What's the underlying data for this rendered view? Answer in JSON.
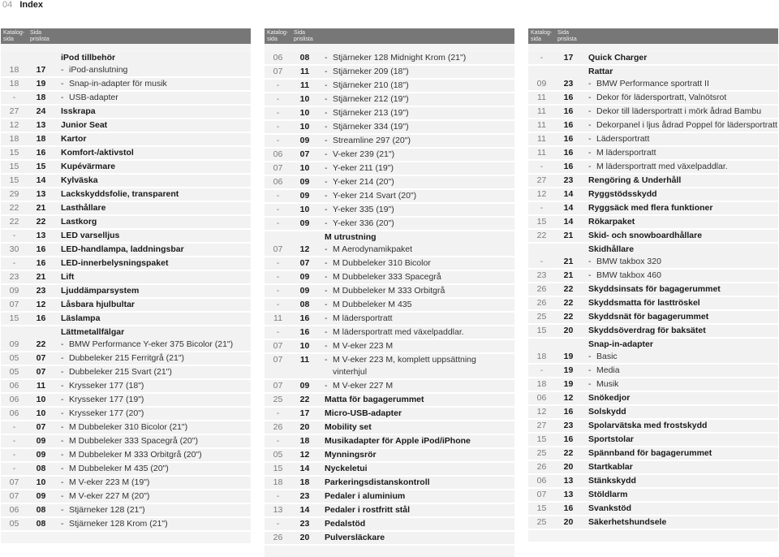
{
  "header": {
    "page_number": "04",
    "title": "Index"
  },
  "column_headers": {
    "katalog": "Katalog- sida",
    "sida": "Sida prislista"
  },
  "columns": [
    {
      "rows": [
        {
          "type": "heading",
          "label": "iPod tillbehör"
        },
        {
          "type": "sub",
          "kat": "18",
          "sida": "17",
          "label": "iPod-anslutning"
        },
        {
          "type": "sub",
          "kat": "18",
          "sida": "19",
          "label": "Snap-in-adapter för musik"
        },
        {
          "type": "sub",
          "kat": "-",
          "sida": "18",
          "label": "USB-adapter"
        },
        {
          "type": "bold",
          "kat": "27",
          "sida": "24",
          "label": "Isskrapa"
        },
        {
          "type": "bold",
          "kat": "12",
          "sida": "13",
          "label": "Junior Seat"
        },
        {
          "type": "bold",
          "kat": "18",
          "sida": "18",
          "label": "Kartor"
        },
        {
          "type": "bold",
          "kat": "15",
          "sida": "16",
          "label": "Komfort-/aktivstol"
        },
        {
          "type": "bold",
          "kat": "15",
          "sida": "15",
          "label": "Kupévärmare"
        },
        {
          "type": "bold",
          "kat": "15",
          "sida": "14",
          "label": "Kylväska"
        },
        {
          "type": "bold",
          "kat": "29",
          "sida": "13",
          "label": "Lackskyddsfolie, transparent"
        },
        {
          "type": "bold",
          "kat": "22",
          "sida": "21",
          "label": "Lasthållare"
        },
        {
          "type": "bold",
          "kat": "22",
          "sida": "22",
          "label": "Lastkorg"
        },
        {
          "type": "bold",
          "kat": "-",
          "sida": "13",
          "label": "LED varselljus"
        },
        {
          "type": "bold",
          "kat": "30",
          "sida": "16",
          "label": "LED-handlampa, laddningsbar"
        },
        {
          "type": "bold",
          "kat": "-",
          "sida": "16",
          "label": "LED-innerbelysningspaket"
        },
        {
          "type": "bold",
          "kat": "23",
          "sida": "21",
          "label": "Lift"
        },
        {
          "type": "bold",
          "kat": "09",
          "sida": "23",
          "label": "Ljuddämparsystem"
        },
        {
          "type": "bold",
          "kat": "07",
          "sida": "12",
          "label": "Låsbara hjulbultar"
        },
        {
          "type": "bold",
          "kat": "15",
          "sida": "16",
          "label": "Läslampa"
        },
        {
          "type": "heading",
          "label": "Lättmetallfälgar"
        },
        {
          "type": "sub",
          "kat": "09",
          "sida": "22",
          "label": "BMW Performance Y-eker 375 Bicolor (21\")"
        },
        {
          "type": "sub",
          "kat": "05",
          "sida": "07",
          "label": "Dubbeleker 215 Ferritgrå (21\")"
        },
        {
          "type": "sub",
          "kat": "05",
          "sida": "07",
          "label": "Dubbeleker 215 Svart (21\")"
        },
        {
          "type": "sub",
          "kat": "06",
          "sida": "11",
          "label": "Krysseker 177 (18\")"
        },
        {
          "type": "sub",
          "kat": "06",
          "sida": "10",
          "label": "Krysseker 177 (19\")"
        },
        {
          "type": "sub",
          "kat": "06",
          "sida": "10",
          "label": "Krysseker 177 (20\")"
        },
        {
          "type": "sub",
          "kat": "-",
          "sida": "07",
          "label": "M Dubbeleker 310 Bicolor (21\")"
        },
        {
          "type": "sub",
          "kat": "-",
          "sida": "09",
          "label": "M Dubbeleker 333 Spacegrå (20\")"
        },
        {
          "type": "sub",
          "kat": "-",
          "sida": "09",
          "label": "M Dubbeleker M 333 Orbitgrå (20\")"
        },
        {
          "type": "sub",
          "kat": "-",
          "sida": "08",
          "label": "M Dubbeleker M 435 (20\")"
        },
        {
          "type": "sub",
          "kat": "07",
          "sida": "10",
          "label": "M V-eker 223 M (19\")"
        },
        {
          "type": "sub",
          "kat": "07",
          "sida": "09",
          "label": "M V-eker 227 M (20\")"
        },
        {
          "type": "sub",
          "kat": "06",
          "sida": "08",
          "label": "Stjärneker 128 (21\")"
        },
        {
          "type": "sub",
          "kat": "05",
          "sida": "08",
          "label": "Stjärneker 128 Krom (21\")"
        }
      ]
    },
    {
      "rows": [
        {
          "type": "sub",
          "kat": "06",
          "sida": "08",
          "label": "Stjärneker 128 Midnight Krom (21\")"
        },
        {
          "type": "sub",
          "kat": "07",
          "sida": "11",
          "label": "Stjärneker 209 (18\")"
        },
        {
          "type": "sub",
          "kat": "-",
          "sida": "11",
          "label": "Stjärneker 210 (18\")"
        },
        {
          "type": "sub",
          "kat": "-",
          "sida": "10",
          "label": "Stjärneker 212 (19\")"
        },
        {
          "type": "sub",
          "kat": "-",
          "sida": "10",
          "label": "Stjärneker 213 (19\")"
        },
        {
          "type": "sub",
          "kat": "-",
          "sida": "10",
          "label": "Stjärneker 334 (19\")"
        },
        {
          "type": "sub",
          "kat": "-",
          "sida": "09",
          "label": "Streamline 297 (20\")"
        },
        {
          "type": "sub",
          "kat": "06",
          "sida": "07",
          "label": "V-eker 239 (21\")"
        },
        {
          "type": "sub",
          "kat": "07",
          "sida": "10",
          "label": "Y-eker 211 (19\")"
        },
        {
          "type": "sub",
          "kat": "06",
          "sida": "09",
          "label": "Y-eker 214 (20\")"
        },
        {
          "type": "sub",
          "kat": "-",
          "sida": "09",
          "label": "Y-eker 214 Svart (20\")"
        },
        {
          "type": "sub",
          "kat": "-",
          "sida": "10",
          "label": "Y-eker 335 (19\")"
        },
        {
          "type": "sub",
          "kat": "-",
          "sida": "09",
          "label": "Y-eker 336 (20\")"
        },
        {
          "type": "heading",
          "label": "M utrustning"
        },
        {
          "type": "sub",
          "kat": "07",
          "sida": "12",
          "label": "M Aerodynamikpaket"
        },
        {
          "type": "sub",
          "kat": "-",
          "sida": "07",
          "label": "M Dubbeleker 310 Bicolor"
        },
        {
          "type": "sub",
          "kat": "-",
          "sida": "09",
          "label": "M Dubbeleker 333 Spacegrå"
        },
        {
          "type": "sub",
          "kat": "-",
          "sida": "09",
          "label": "M Dubbeleker M 333 Orbitgrå"
        },
        {
          "type": "sub",
          "kat": "-",
          "sida": "08",
          "label": "M Dubbeleker M 435"
        },
        {
          "type": "sub",
          "kat": "11",
          "sida": "16",
          "label": "M lädersportratt"
        },
        {
          "type": "sub",
          "kat": "-",
          "sida": "16",
          "label": "M lädersportratt med växelpaddlar."
        },
        {
          "type": "sub",
          "kat": "07",
          "sida": "10",
          "label": "M V-eker 223 M"
        },
        {
          "type": "sub2",
          "kat": "07",
          "sida": "11",
          "label": "M V-eker 223 M, komplett uppsättning vinterhjul"
        },
        {
          "type": "sub",
          "kat": "07",
          "sida": "09",
          "label": "M V-eker 227 M"
        },
        {
          "type": "bold",
          "kat": "25",
          "sida": "22",
          "label": "Matta för bagagerummet"
        },
        {
          "type": "bold",
          "kat": "-",
          "sida": "17",
          "label": "Micro-USB-adapter"
        },
        {
          "type": "bold",
          "kat": "26",
          "sida": "20",
          "label": "Mobility set"
        },
        {
          "type": "bold",
          "kat": "-",
          "sida": "18",
          "label": "Musikadapter för Apple iPod/iPhone"
        },
        {
          "type": "bold",
          "kat": "05",
          "sida": "12",
          "label": "Mynningsrör"
        },
        {
          "type": "bold",
          "kat": "15",
          "sida": "14",
          "label": "Nyckeletui"
        },
        {
          "type": "bold",
          "kat": "18",
          "sida": "18",
          "label": "Parkeringsdistanskontroll"
        },
        {
          "type": "bold",
          "kat": "-",
          "sida": "23",
          "label": "Pedaler i aluminium"
        },
        {
          "type": "bold",
          "kat": "13",
          "sida": "14",
          "label": "Pedaler i rostfritt stål"
        },
        {
          "type": "bold",
          "kat": "-",
          "sida": "23",
          "label": "Pedalstöd"
        },
        {
          "type": "bold",
          "kat": "26",
          "sida": "20",
          "label": "Pulversläckare"
        }
      ]
    },
    {
      "rows": [
        {
          "type": "bold",
          "kat": "-",
          "sida": "17",
          "label": "Quick Charger"
        },
        {
          "type": "heading",
          "label": "Rattar"
        },
        {
          "type": "sub",
          "kat": "09",
          "sida": "23",
          "label": "BMW Performance sportratt II"
        },
        {
          "type": "sub",
          "kat": "11",
          "sida": "16",
          "label": "Dekor för lädersportratt, Valnötsrot"
        },
        {
          "type": "sub",
          "kat": "11",
          "sida": "16",
          "label": "Dekor till lädersportratt i mörk ådrad Bambu"
        },
        {
          "type": "sub",
          "kat": "11",
          "sida": "16",
          "label": "Dekorpanel i ljus ådrad Poppel för lädersportratt"
        },
        {
          "type": "sub",
          "kat": "11",
          "sida": "16",
          "label": "Lädersportratt"
        },
        {
          "type": "sub",
          "kat": "11",
          "sida": "16",
          "label": "M lädersportratt"
        },
        {
          "type": "sub",
          "kat": "-",
          "sida": "16",
          "label": "M lädersportratt med växelpaddlar."
        },
        {
          "type": "bold",
          "kat": "27",
          "sida": "23",
          "label": "Rengöring & Underhåll"
        },
        {
          "type": "bold",
          "kat": "12",
          "sida": "14",
          "label": "Ryggstödsskydd"
        },
        {
          "type": "bold",
          "kat": "-",
          "sida": "14",
          "label": "Ryggsäck med flera funktioner"
        },
        {
          "type": "bold",
          "kat": "15",
          "sida": "14",
          "label": "Rökarpaket"
        },
        {
          "type": "bold",
          "kat": "22",
          "sida": "21",
          "label": "Skid- och snowboardhållare"
        },
        {
          "type": "heading",
          "label": "Skidhållare"
        },
        {
          "type": "sub",
          "kat": "-",
          "sida": "21",
          "label": "BMW takbox 320"
        },
        {
          "type": "sub",
          "kat": "23",
          "sida": "21",
          "label": "BMW takbox 460"
        },
        {
          "type": "bold",
          "kat": "26",
          "sida": "22",
          "label": "Skyddsinsats för bagagerummet"
        },
        {
          "type": "bold",
          "kat": "26",
          "sida": "22",
          "label": "Skyddsmatta för lasttröskel"
        },
        {
          "type": "bold",
          "kat": "25",
          "sida": "22",
          "label": "Skyddsnät för bagagerummet"
        },
        {
          "type": "bold",
          "kat": "15",
          "sida": "20",
          "label": "Skyddsöverdrag för baksätet"
        },
        {
          "type": "heading",
          "label": "Snap-in-adapter"
        },
        {
          "type": "sub",
          "kat": "18",
          "sida": "19",
          "label": "Basic"
        },
        {
          "type": "sub",
          "kat": "-",
          "sida": "19",
          "label": "Media"
        },
        {
          "type": "sub",
          "kat": "18",
          "sida": "19",
          "label": "Musik"
        },
        {
          "type": "bold",
          "kat": "06",
          "sida": "12",
          "label": "Snökedjor"
        },
        {
          "type": "bold",
          "kat": "12",
          "sida": "16",
          "label": "Solskydd"
        },
        {
          "type": "bold",
          "kat": "27",
          "sida": "23",
          "label": "Spolarvätska med frostskydd"
        },
        {
          "type": "bold",
          "kat": "15",
          "sida": "16",
          "label": "Sportstolar"
        },
        {
          "type": "bold",
          "kat": "25",
          "sida": "22",
          "label": "Spännband för bagagerummet"
        },
        {
          "type": "bold",
          "kat": "26",
          "sida": "20",
          "label": "Startkablar"
        },
        {
          "type": "bold",
          "kat": "06",
          "sida": "13",
          "label": "Stänkskydd"
        },
        {
          "type": "bold",
          "kat": "07",
          "sida": "13",
          "label": "Stöldlarm"
        },
        {
          "type": "bold",
          "kat": "15",
          "sida": "16",
          "label": "Svankstöd"
        },
        {
          "type": "bold",
          "kat": "25",
          "sida": "20",
          "label": "Säkerhetshundsele"
        }
      ]
    }
  ],
  "colors": {
    "header_bar": "#777777",
    "row_bg": "#f2f2f2",
    "sida_col_bg": "#ececec",
    "kat_text": "#7a7a7a"
  }
}
